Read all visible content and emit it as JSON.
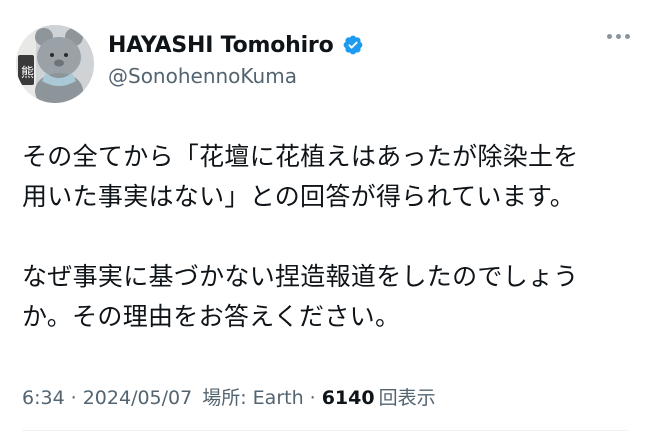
{
  "author": {
    "display_name": "HAYASHI Tomohiro",
    "handle": "@SonohennoKuma",
    "avatar_icon": "teddy-bear-avatar-icon",
    "verified_icon": "verified-badge-icon",
    "verified_color": "#1d9bf0"
  },
  "menu_icon": "more-options-icon",
  "tweet": {
    "paragraph_1": "その全てから「花壇に花植えはあったが除染土を\n用いた事実はない」との回答が得られています。",
    "paragraph_2": "なぜ事実に基づかない捏造報道をしたのでしょう\nか。その理由をお答えください。"
  },
  "meta": {
    "time": "6:34",
    "separator": "·",
    "date": "2024/05/07",
    "location": "場所: Earth",
    "views_count": "6140",
    "views_label": "回表示"
  }
}
